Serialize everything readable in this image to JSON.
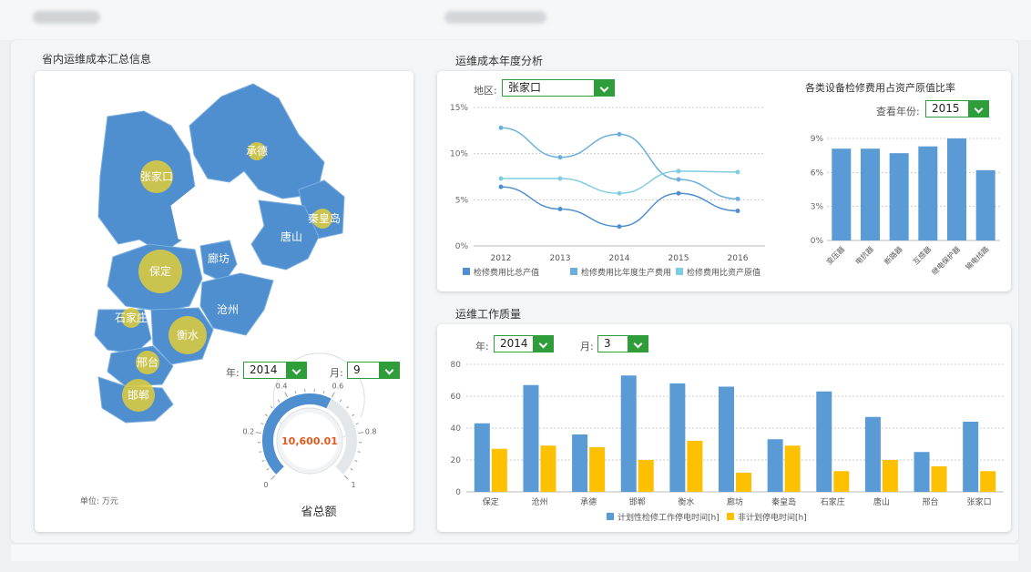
{
  "header": {},
  "left": {
    "title": "省内运维成本汇总信息",
    "year_label": "年:",
    "year_value": "2014",
    "month_label": "月:",
    "month_value": "9",
    "unit_label": "单位: 万元",
    "total_value": "10,600.01",
    "total_label": "省总额",
    "gauge_ticks": [
      "0",
      "0.2",
      "0.4",
      "0.6",
      "0.8",
      "1"
    ],
    "gauge_fraction": 0.6,
    "regions": [
      "张家口",
      "承德",
      "秦皇岛",
      "唐山",
      "廊坊",
      "保定",
      "沧州",
      "石家庄",
      "衡水",
      "邢台",
      "邯郸"
    ]
  },
  "annual": {
    "title": "运维成本年度分析",
    "region_label": "地区:",
    "region_value": "张家口",
    "ratio_title": "各类设备检修费用占资产原值比率",
    "year_label": "查看年份:",
    "year_value": "2015"
  },
  "quality": {
    "title": "运维工作质量",
    "year_label": "年:",
    "year_value": "2014",
    "month_label": "月:",
    "month_value": "3"
  },
  "colors": {
    "dark_blue": "#4f8fd0",
    "mid_blue": "#6bb0dc",
    "light_blue": "#7fcde0",
    "bar_blue": "#5b9bd5",
    "yellow": "#ffc000",
    "map_blue": "#4f8fd0",
    "bubble": "#e0cc3a",
    "green": "#2e9d3a"
  },
  "chart_data": [
    {
      "id": "line",
      "type": "line",
      "x": [
        2012,
        2013,
        2014,
        2015,
        2016
      ],
      "xticks": [
        "2012",
        "2013",
        "2014",
        "2015",
        "2016"
      ],
      "ylim": [
        0,
        15
      ],
      "yticks": [
        "0%",
        "5%",
        "10%",
        "15%"
      ],
      "grid": true,
      "legend_placement": "bottom",
      "series": [
        {
          "name": "检修费用比总产值",
          "values": [
            6.4,
            4.0,
            2.1,
            5.7,
            3.8
          ]
        },
        {
          "name": "检修费用比年度生产费用",
          "values": [
            12.8,
            9.6,
            12.1,
            7.2,
            5.1
          ]
        },
        {
          "name": "检修费用比资产原值",
          "values": [
            7.3,
            7.3,
            5.7,
            8.1,
            8.0
          ]
        }
      ]
    },
    {
      "id": "ratio",
      "type": "bar",
      "categories": [
        "变压器",
        "电抗器",
        "断路器",
        "互感器",
        "继电保护器",
        "输电线路"
      ],
      "values": [
        8.1,
        8.1,
        7.7,
        8.3,
        9.0,
        6.2
      ],
      "ylim": [
        0,
        9
      ],
      "yticks": [
        "0%",
        "3%",
        "6%",
        "9%"
      ],
      "grid": true
    },
    {
      "id": "quality",
      "type": "bar",
      "categories": [
        "保定",
        "沧州",
        "承德",
        "邯郸",
        "衡水",
        "廊坊",
        "秦皇岛",
        "石家庄",
        "唐山",
        "邢台",
        "张家口"
      ],
      "ylim": [
        0,
        80
      ],
      "yticks": [
        "0",
        "20",
        "40",
        "60",
        "80"
      ],
      "grid": true,
      "legend_placement": "bottom",
      "series": [
        {
          "name": "计划性检修工作停电时间[h]",
          "values": [
            43,
            67,
            36,
            73,
            68,
            66,
            33,
            63,
            47,
            25,
            44
          ]
        },
        {
          "name": "非计划停电时间[h]",
          "values": [
            27,
            29,
            28,
            20,
            32,
            12,
            29,
            13,
            20,
            16,
            13
          ]
        }
      ]
    }
  ]
}
